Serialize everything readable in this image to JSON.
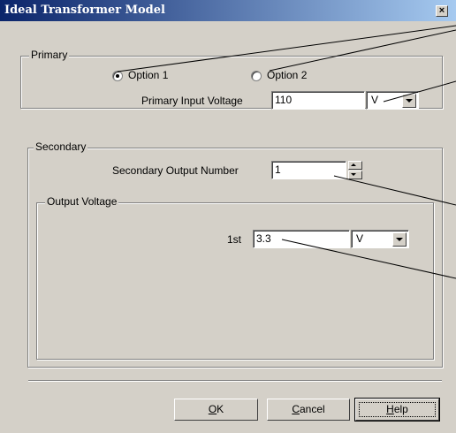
{
  "window": {
    "title": "Ideal Transformer Model",
    "close_label": "×"
  },
  "primary": {
    "legend": "Primary",
    "option1_label": "Option 1",
    "option2_label": "Option 2",
    "selected": "Option 1",
    "input_voltage_label": "Primary Input Voltage",
    "input_voltage_value": "110",
    "unit_value": "V"
  },
  "secondary": {
    "legend": "Secondary",
    "output_number_label": "Secondary Output Number",
    "output_number_value": "1",
    "output_voltage": {
      "legend": "Output Voltage",
      "row_label": "1st",
      "value": "3.3",
      "unit_value": "V"
    }
  },
  "buttons": {
    "ok_mnemonic": "O",
    "ok_rest": "K",
    "cancel_mnemonic": "C",
    "cancel_rest": "ancel",
    "help_mnemonic": "H",
    "help_rest": "elp"
  }
}
